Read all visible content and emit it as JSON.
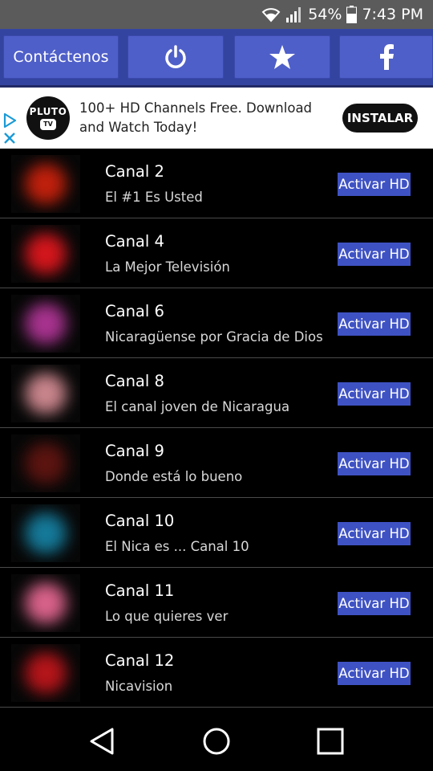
{
  "status_bar": {
    "battery_percent": "54%",
    "time": "7:43 PM"
  },
  "toolbar": {
    "contact_label": "Contáctenos"
  },
  "ad": {
    "logo_line1": "PLUTO",
    "logo_line2": "TV",
    "text": "100+ HD Channels Free. Download and Watch Today!",
    "install_label": "INSTALAR"
  },
  "channels": [
    {
      "name": "Canal 2",
      "slogan": "El #1 Es Usted",
      "action": "Activar HD",
      "thumb_color": "#c0200c"
    },
    {
      "name": "Canal 4",
      "slogan": "La Mejor Televisión",
      "action": "Activar HD",
      "thumb_color": "#d4161c"
    },
    {
      "name": "Canal 6",
      "slogan": "Nicaragüense por Gracia de Dios",
      "action": "Activar HD",
      "thumb_color": "#a8338f"
    },
    {
      "name": "Canal 8",
      "slogan": "El canal joven de Nicaragua",
      "action": "Activar HD",
      "thumb_color": "#c9858c"
    },
    {
      "name": "Canal 9",
      "slogan": "Donde está lo bueno",
      "action": "Activar HD",
      "thumb_color": "#5c1410"
    },
    {
      "name": "Canal 10",
      "slogan": "El Nica es ... Canal 10",
      "action": "Activar HD",
      "thumb_color": "#157a9a"
    },
    {
      "name": "Canal 11",
      "slogan": "Lo que quieres ver",
      "action": "Activar HD",
      "thumb_color": "#d9628a"
    },
    {
      "name": "Canal 12",
      "slogan": "Nicavision",
      "action": "Activar HD",
      "thumb_color": "#b5151a"
    }
  ]
}
